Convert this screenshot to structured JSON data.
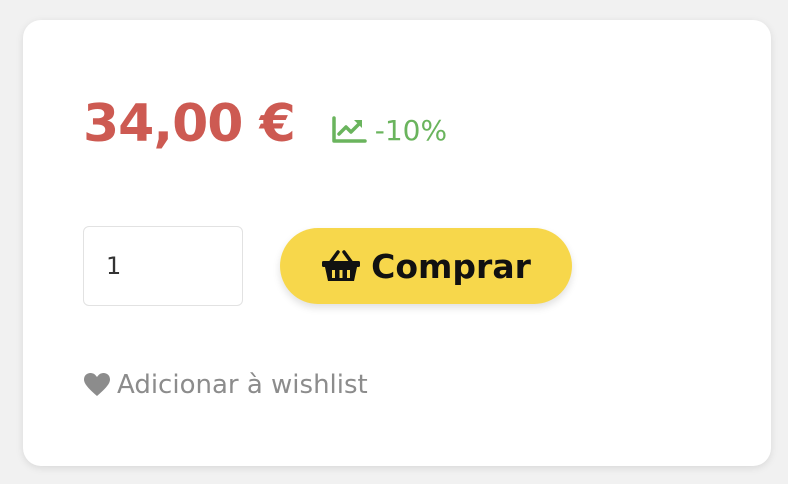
{
  "product": {
    "price": "34,00 €",
    "discount": "-10%",
    "quantity": "1",
    "buy_label": "Comprar",
    "wishlist_label": "Adicionar à wishlist"
  },
  "icons": {
    "discount": "chart-line-icon",
    "buy": "basket-icon",
    "wishlist": "heart-icon"
  },
  "colors": {
    "price": "#cd5a52",
    "discount": "#6ab45d",
    "buy_button": "#f7d74b",
    "wishlist": "#8c8c8c"
  }
}
